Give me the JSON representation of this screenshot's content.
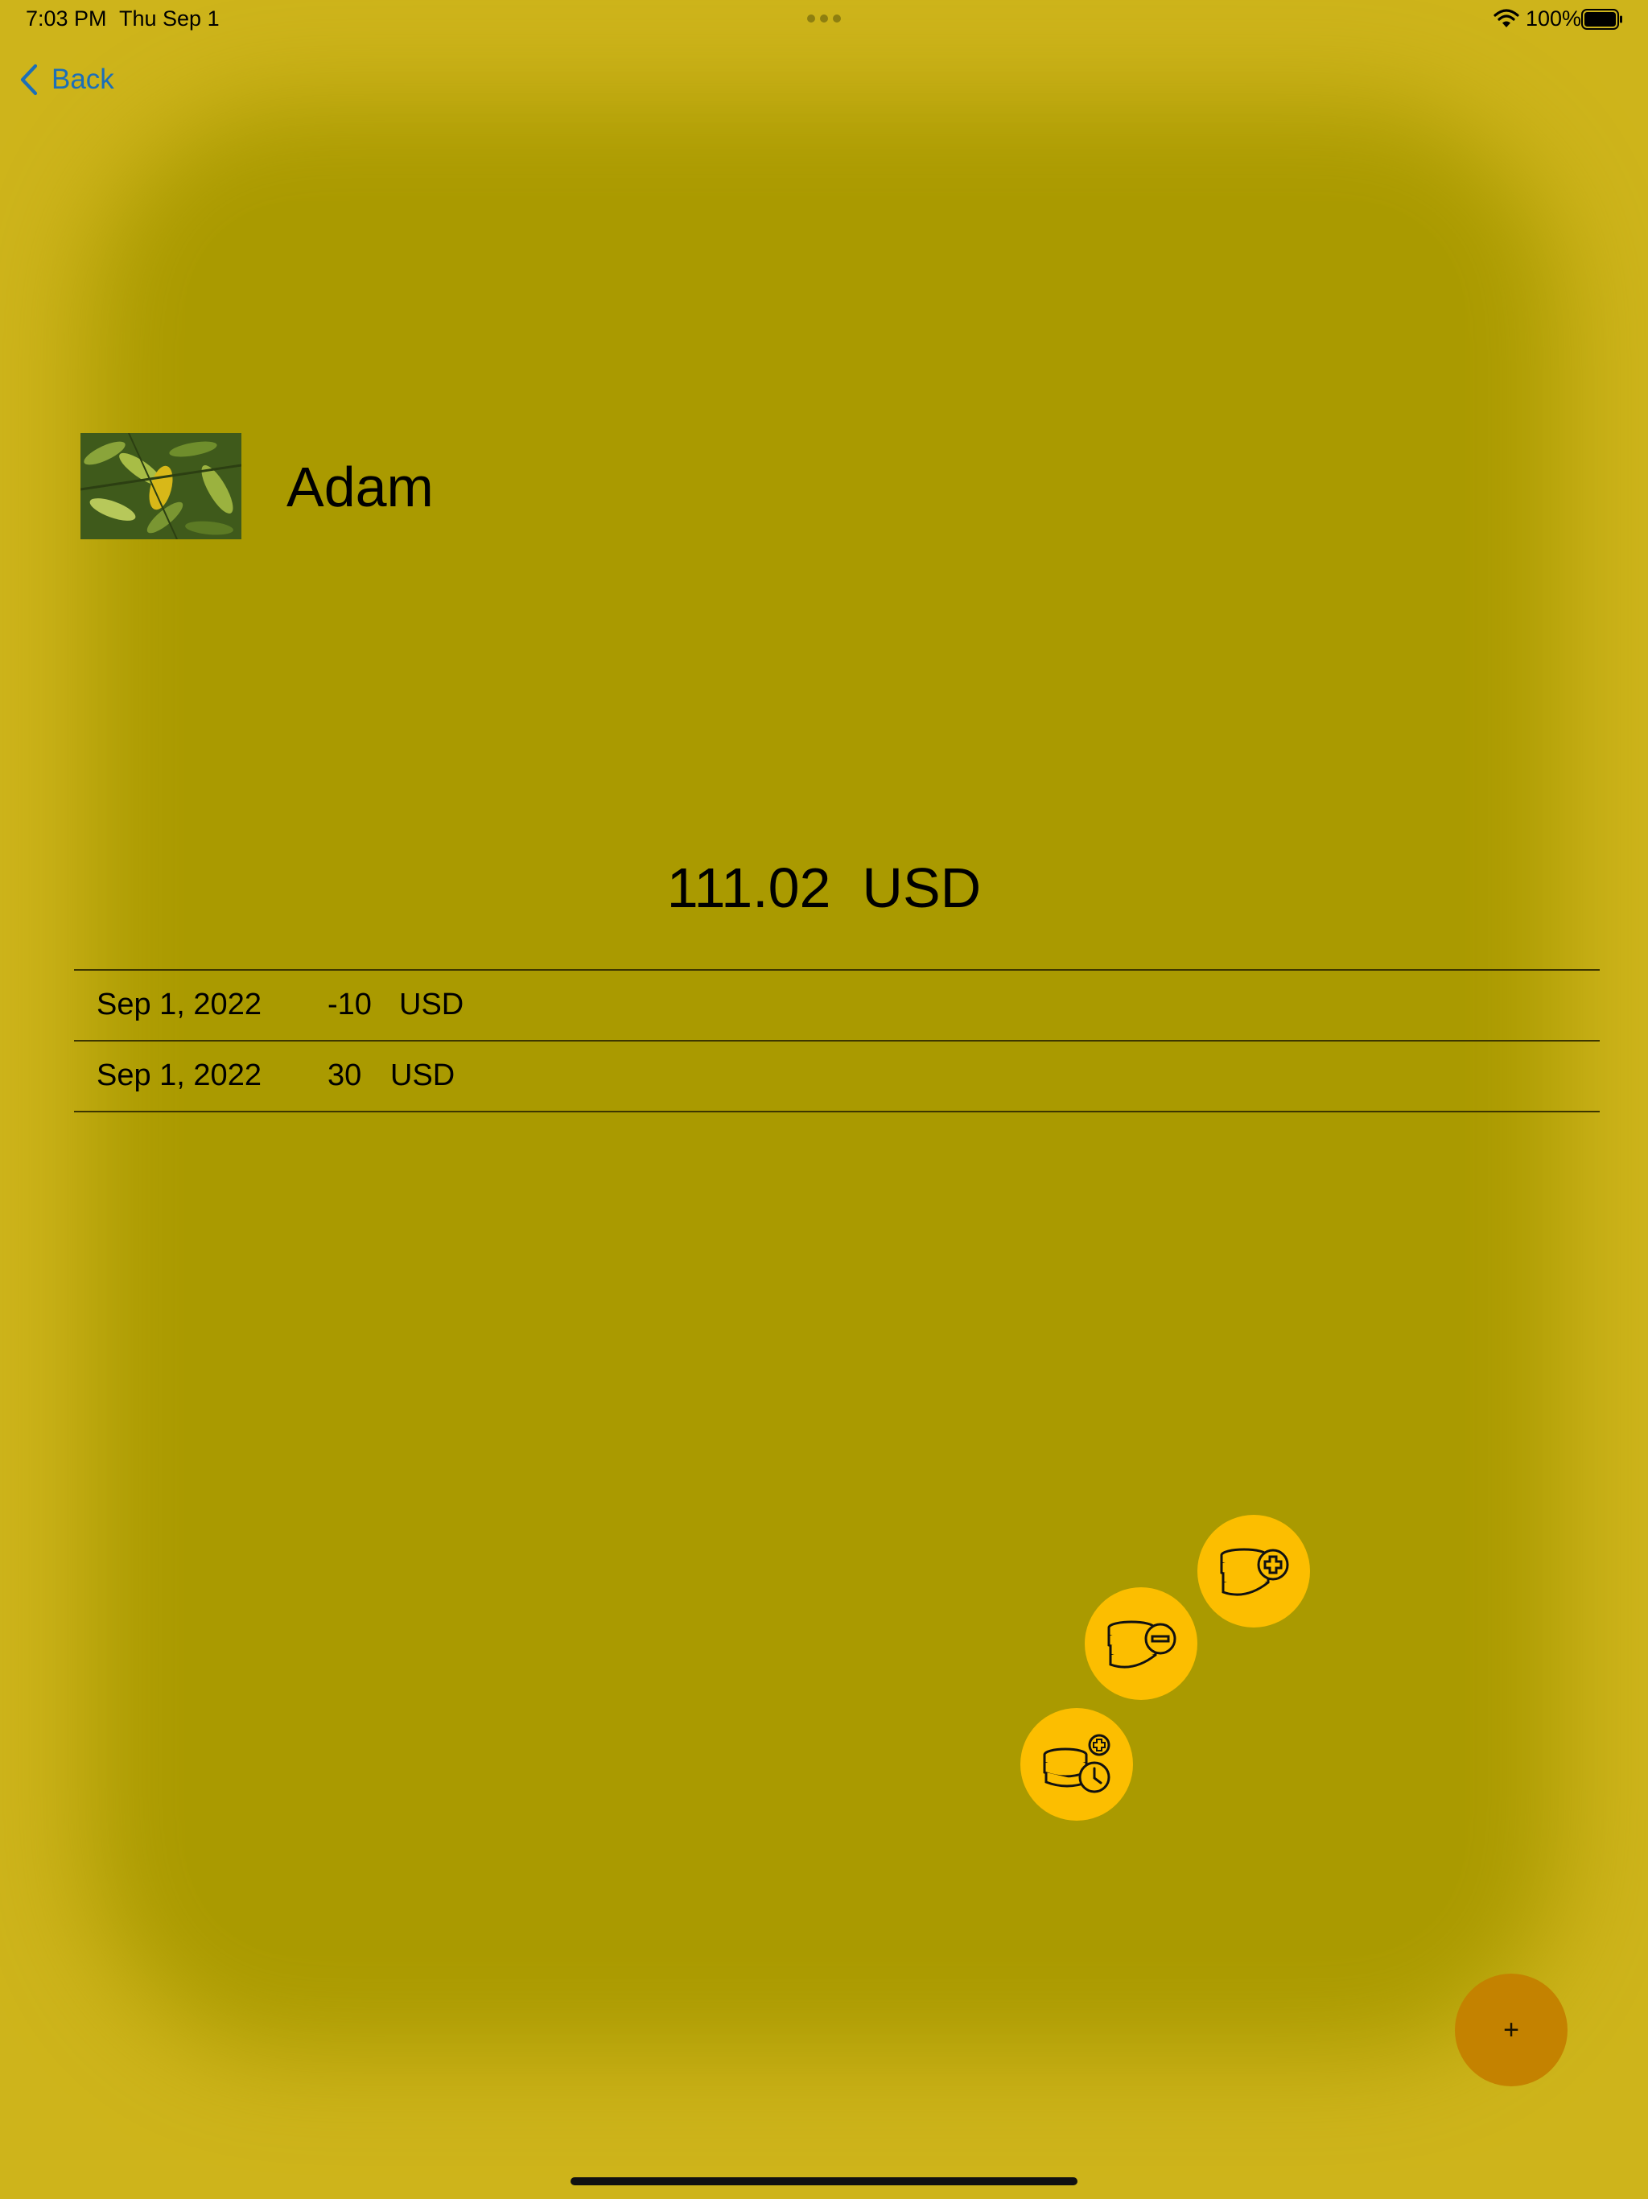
{
  "status_bar": {
    "time": "7:03 PM",
    "date": "Thu Sep 1",
    "battery": "100%",
    "icons": [
      "wifi-icon",
      "battery-icon",
      "multitasking-dots-icon"
    ]
  },
  "nav": {
    "back_label": "Back",
    "back_icon": "chevron-left-icon"
  },
  "profile": {
    "name": "Adam",
    "avatar": "photo-thumbnail"
  },
  "balance": {
    "amount": "111.02",
    "currency": "USD"
  },
  "transactions": [
    {
      "date": "Sep 1, 2022",
      "amount": "-10",
      "currency": "USD"
    },
    {
      "date": "Sep 1, 2022",
      "amount": "30",
      "currency": "USD"
    }
  ],
  "fab_actions": [
    {
      "icon": "coins-plus-icon",
      "action": "add"
    },
    {
      "icon": "coins-minus-icon",
      "action": "subtract"
    },
    {
      "icon": "coins-clock-plus-icon",
      "action": "scheduled"
    }
  ],
  "fab": {
    "label": "+"
  },
  "colors": {
    "background": "#ceb41b",
    "overlay": "#aa9a00",
    "link": "#1c6fb8",
    "action_button": "#fcbe00",
    "main_button": "#c48200"
  }
}
